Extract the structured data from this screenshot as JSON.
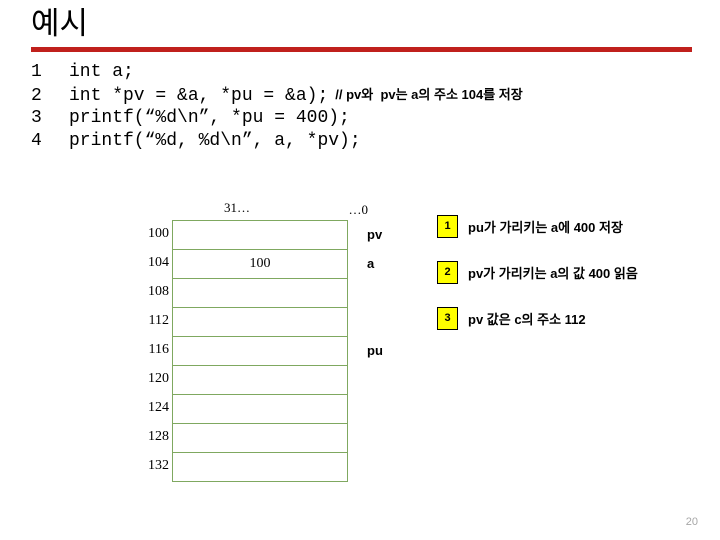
{
  "slide": {
    "title": "예시",
    "page_number": "20",
    "accent_rule_color": "#C0201C",
    "table_border_color": "#7FA860",
    "badge_color": "#FFFF00"
  },
  "code": {
    "lines": [
      {
        "no": "1",
        "text": "int a;",
        "comment": ""
      },
      {
        "no": "2",
        "text": "int *pv = &a, *pu = &a);",
        "comment": "// pv와  pv는 a의 주소 104를 저장"
      },
      {
        "no": "3",
        "text": "printf(“%d\\n”, *pu = 400);",
        "comment": ""
      },
      {
        "no": "4",
        "text": "printf(“%d, %d\\n”, a, *pv);",
        "comment": ""
      }
    ]
  },
  "memory": {
    "bit_label_high": "31…",
    "bit_label_low": "…0",
    "rows": [
      {
        "address": "100",
        "value": "",
        "variable": "pv"
      },
      {
        "address": "104",
        "value": "100",
        "variable": "a"
      },
      {
        "address": "108",
        "value": "",
        "variable": ""
      },
      {
        "address": "112",
        "value": "",
        "variable": ""
      },
      {
        "address": "116",
        "value": "",
        "variable": "pu"
      },
      {
        "address": "120",
        "value": "",
        "variable": ""
      },
      {
        "address": "124",
        "value": "",
        "variable": ""
      },
      {
        "address": "128",
        "value": "",
        "variable": ""
      },
      {
        "address": "132",
        "value": "",
        "variable": ""
      }
    ]
  },
  "annotations": [
    {
      "number": "1",
      "text": "pu가 가리키는 a에 400 저장"
    },
    {
      "number": "2",
      "text": "pv가 가리키는 a의 값 400 읽음"
    },
    {
      "number": "3",
      "text": "pv  값은 c의 주소 112"
    }
  ]
}
